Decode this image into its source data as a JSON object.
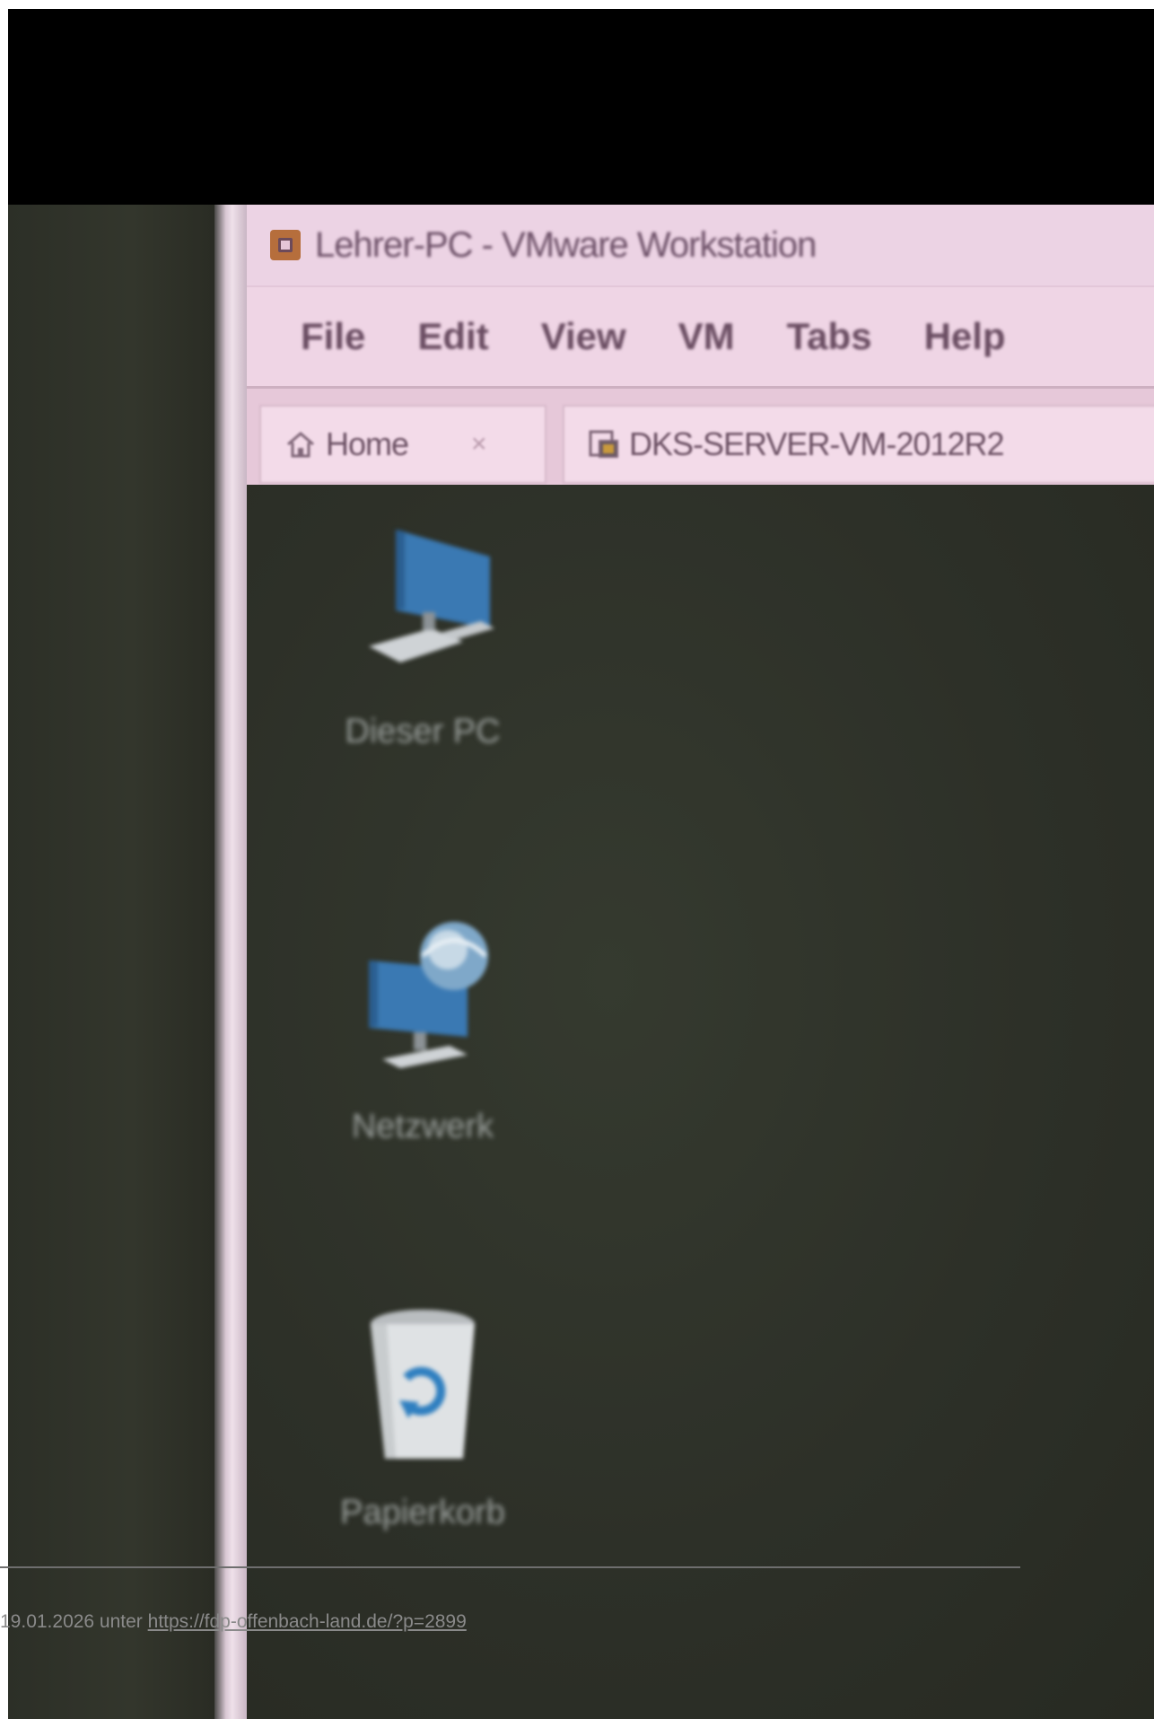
{
  "window": {
    "title": "Lehrer-PC - VMware Workstation"
  },
  "menubar": {
    "items": [
      "File",
      "Edit",
      "View",
      "VM",
      "Tabs",
      "Help"
    ]
  },
  "tabs": [
    {
      "label": "Home",
      "close": "×",
      "icon": "home-icon"
    },
    {
      "label": "DKS-SERVER-VM-2012R2",
      "icon": "vm-icon"
    }
  ],
  "desktop": {
    "icons": [
      {
        "label": "Dieser PC",
        "icon": "computer-icon"
      },
      {
        "label": "Netzwerk",
        "icon": "network-icon"
      },
      {
        "label": "Papierkorb",
        "icon": "recycle-bin-icon"
      }
    ]
  },
  "footer": {
    "prefix": "19.01.2026 unter ",
    "link": "https://fdp-offenbach-land.de/?p=2899"
  },
  "colors": {
    "titlebar": "#ecd3e4",
    "desktop": "#2f332a",
    "icon_blue": "#3a79b3"
  }
}
